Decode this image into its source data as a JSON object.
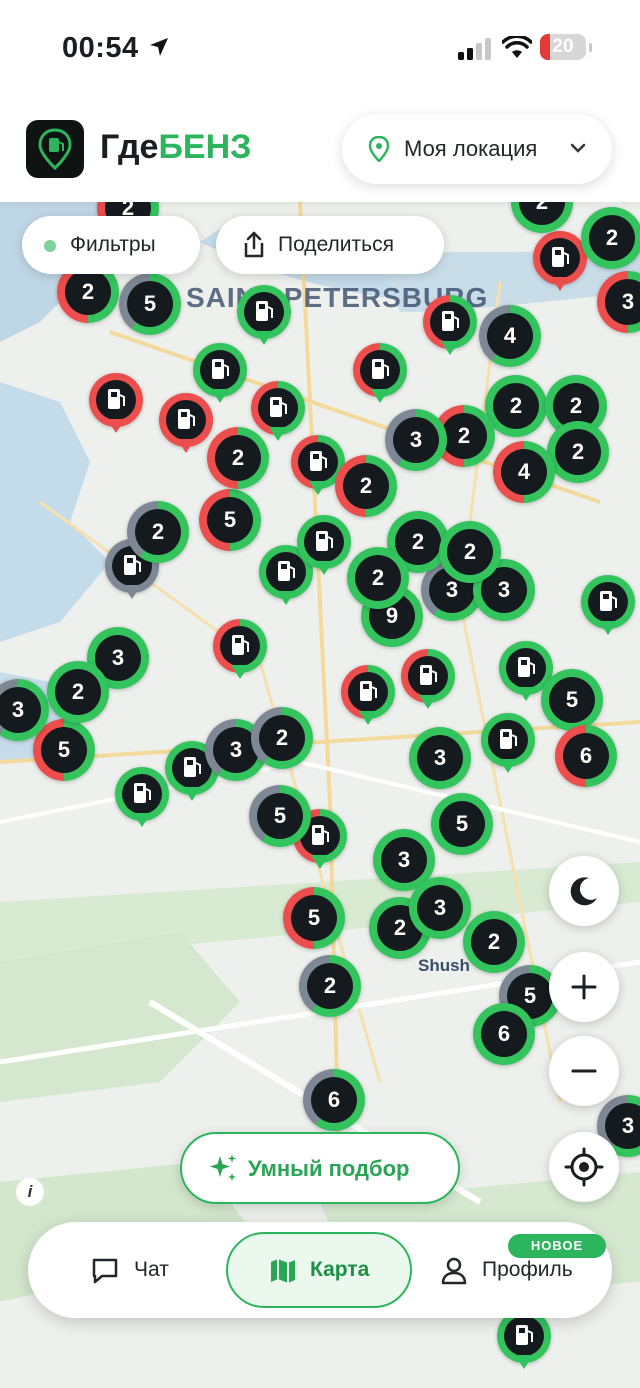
{
  "status": {
    "time": "00:54",
    "battery": "20"
  },
  "header": {
    "app_name_prefix": "Где",
    "app_name_accent": "БЕНЗ",
    "location_label": "Моя локация"
  },
  "map": {
    "filters_label": "Фильтры",
    "share_label": "Поделиться",
    "city_label": "SAINT PETERSBURG",
    "district_label": "Shush",
    "info_label": "i",
    "cluster_markers": [
      {
        "count": "2"
      },
      {
        "count": "2"
      },
      {
        "count": "5"
      },
      {
        "count": "4"
      },
      {
        "count": "2"
      },
      {
        "count": "2"
      },
      {
        "count": "3"
      },
      {
        "count": "2"
      },
      {
        "count": "2"
      },
      {
        "count": "2"
      },
      {
        "count": "4"
      },
      {
        "count": "2"
      },
      {
        "count": "5"
      },
      {
        "count": "2"
      },
      {
        "count": "2"
      },
      {
        "count": "2"
      },
      {
        "count": "3"
      },
      {
        "count": "3"
      },
      {
        "count": "2"
      },
      {
        "count": "9"
      },
      {
        "count": "3"
      },
      {
        "count": "2"
      },
      {
        "count": "2"
      },
      {
        "count": "3"
      },
      {
        "count": "5"
      },
      {
        "count": "3"
      },
      {
        "count": "2"
      },
      {
        "count": "5"
      },
      {
        "count": "3"
      },
      {
        "count": "6"
      },
      {
        "count": "5"
      },
      {
        "count": "5"
      },
      {
        "count": "3"
      },
      {
        "count": "3"
      },
      {
        "count": "5"
      },
      {
        "count": "2"
      },
      {
        "count": "2"
      },
      {
        "count": "2"
      },
      {
        "count": "5"
      },
      {
        "count": "6"
      },
      {
        "count": "6"
      },
      {
        "count": "3"
      },
      {
        "count": "3"
      },
      {
        "count": "2"
      }
    ],
    "smart_pick_label": "Умный подбор"
  },
  "tabs": {
    "chat": "Чат",
    "map": "Карта",
    "profile": "Профиль",
    "new_badge": "НОВОЕ"
  },
  "colors": {
    "accent": "#2db55d",
    "marker_green": "#33c45e",
    "marker_red": "#ec4d4d",
    "marker_gray": "#7e8794"
  }
}
